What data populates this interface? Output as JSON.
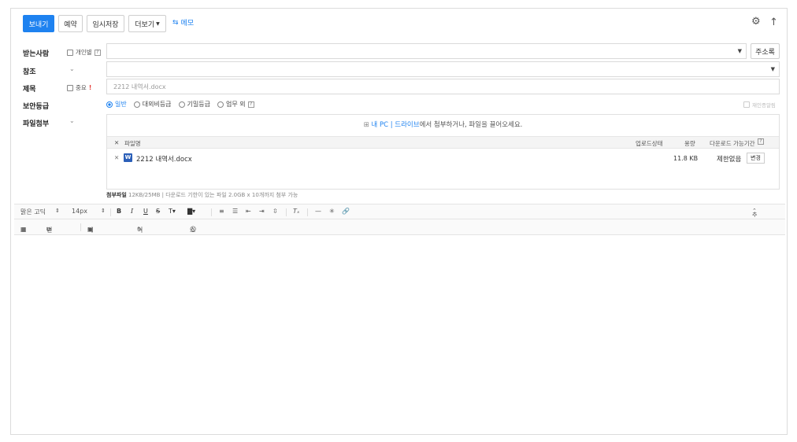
{
  "toolbar": {
    "send": "보내기",
    "reserve": "예약",
    "temp_save": "임시저장",
    "more": "더보기",
    "memo": "메모"
  },
  "recipient": {
    "label": "받는사람",
    "personal_label": "개인별",
    "address_book": "주소록"
  },
  "cc": {
    "label": "참조"
  },
  "subject": {
    "label": "제목",
    "important_label": "중요",
    "important_mark": "!",
    "value": "2212 내역서.docx"
  },
  "security": {
    "label": "보안등급",
    "options": [
      "일반",
      "대외비등급",
      "기밀등급",
      "업무 외"
    ],
    "selected": "일반",
    "right_label": "재인증알림"
  },
  "attachment": {
    "label": "파일첨부",
    "drop_my_pc": "내 PC",
    "drop_drive": "드라이브",
    "drop_rest": "에서 첨부하거나, 파일을 끌어오세요.",
    "columns": {
      "filename": "파일명",
      "status": "업로드상태",
      "size": "용량",
      "period": "다운로드 가능기간"
    },
    "files": [
      {
        "name": "2212 내역서.docx",
        "size": "11.8 KB",
        "period": "제한없음",
        "change": "변경"
      }
    ],
    "info_title": "첨부파일",
    "info_text": "12KB/25MB | 다운로드 기한이 있는 파일 2.0GB x 10개까지 첨부 가능"
  },
  "editor": {
    "font": "맑은 고딕",
    "size": "14px",
    "more_features": "추가기능",
    "table": "표",
    "translate": "번역",
    "insert_image": "이미지 삽입",
    "edit_image": "이미지 편집",
    "sticker": "스티커"
  }
}
